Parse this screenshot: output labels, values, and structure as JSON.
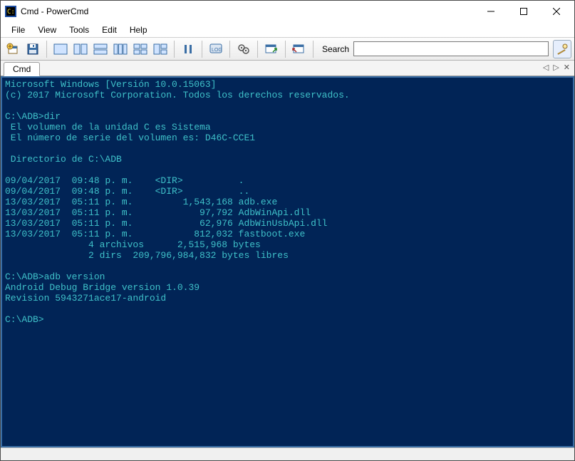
{
  "window": {
    "title": "Cmd - PowerCmd"
  },
  "menu": {
    "file": "File",
    "view": "View",
    "tools": "Tools",
    "edit": "Edit",
    "help": "Help"
  },
  "toolbar": {
    "search_label": "Search"
  },
  "tabs": {
    "cmd": "Cmd"
  },
  "terminal": {
    "content": "Microsoft Windows [Versión 10.0.15063]\n(c) 2017 Microsoft Corporation. Todos los derechos reservados.\n\nC:\\ADB>dir\n El volumen de la unidad C es Sistema\n El número de serie del volumen es: D46C-CCE1\n\n Directorio de C:\\ADB\n\n09/04/2017  09:48 p. m.    <DIR>          .\n09/04/2017  09:48 p. m.    <DIR>          ..\n13/03/2017  05:11 p. m.         1,543,168 adb.exe\n13/03/2017  05:11 p. m.            97,792 AdbWinApi.dll\n13/03/2017  05:11 p. m.            62,976 AdbWinUsbApi.dll\n13/03/2017  05:11 p. m.           812,032 fastboot.exe\n               4 archivos      2,515,968 bytes\n               2 dirs  209,796,984,832 bytes libres\n\nC:\\ADB>adb version\nAndroid Debug Bridge version 1.0.39\nRevision 5943271ace17-android\n\nC:\\ADB>"
  }
}
